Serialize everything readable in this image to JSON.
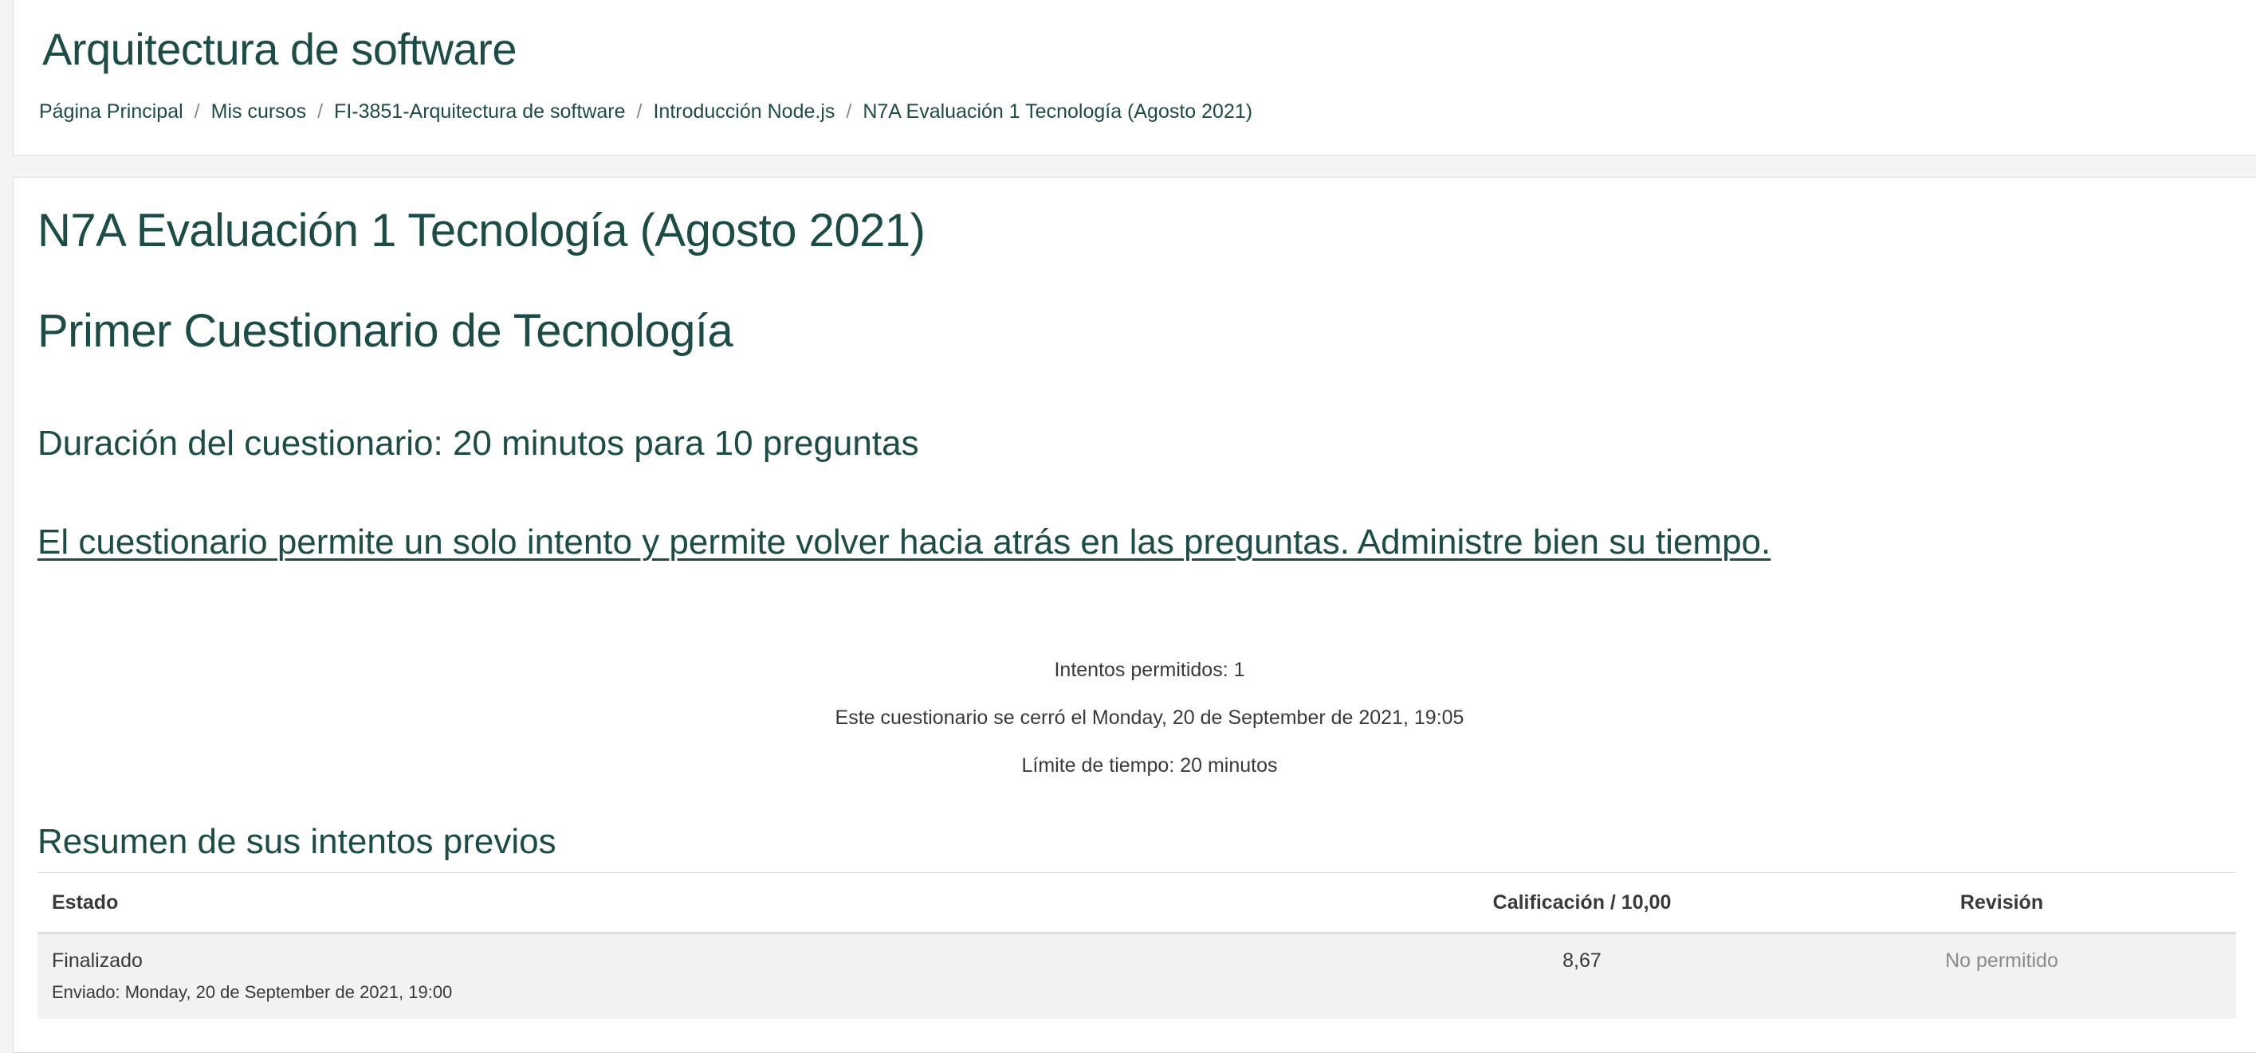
{
  "header": {
    "course_title": "Arquitectura de software",
    "breadcrumb": [
      {
        "label": "Página Principal"
      },
      {
        "label": "Mis cursos"
      },
      {
        "label": "FI-3851-Arquitectura de software"
      },
      {
        "label": "Introducción Node.js"
      },
      {
        "label": "N7A Evaluación 1 Tecnología (Agosto 2021)"
      }
    ],
    "separator": "/"
  },
  "main": {
    "activity_title": "N7A Evaluación 1 Tecnología (Agosto 2021)",
    "quiz_subtitle": "Primer Cuestionario de Tecnología",
    "duration_text": "Duración del cuestionario: 20 minutos para 10 preguntas",
    "attempt_notice": "El cuestionario permite un solo intento y permite volver hacia atrás en las preguntas. Administre bien su tiempo.",
    "info": {
      "attempts_allowed": "Intentos permitidos: 1",
      "closed_on": "Este cuestionario se cerró el Monday, 20 de September de 2021, 19:05",
      "time_limit": "Límite de tiempo: 20 minutos"
    },
    "summary": {
      "heading": "Resumen de sus intentos previos",
      "columns": {
        "state": "Estado",
        "grade": "Calificación / 10,00",
        "review": "Revisión"
      },
      "rows": [
        {
          "state": "Finalizado",
          "submitted": "Enviado: Monday, 20 de September de 2021, 19:00",
          "grade": "8,67",
          "review": "No permitido"
        }
      ]
    }
  },
  "colors": {
    "brand_green": "#1d4c47",
    "text": "#373a3c",
    "muted": "#8a8a8a",
    "row_bg": "#f2f2f2"
  }
}
